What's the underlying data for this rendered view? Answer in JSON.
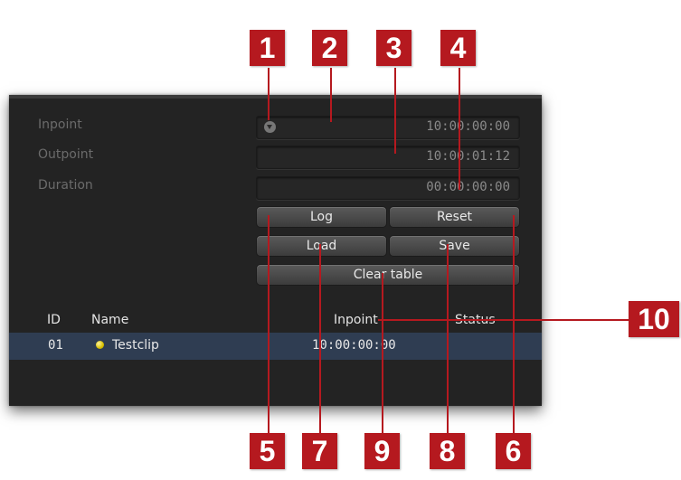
{
  "fields": {
    "inpoint_label": "Inpoint",
    "outpoint_label": "Outpoint",
    "duration_label": "Duration",
    "inpoint_value": "10:00:00:00",
    "outpoint_value": "10:00:01:12",
    "duration_value": "00:00:00:00"
  },
  "buttons": {
    "log": "Log",
    "reset": "Reset",
    "load": "Load",
    "save": "Save",
    "clear_table": "Clear table"
  },
  "table": {
    "columns": [
      "ID",
      "Name",
      "Inpoint",
      "Status"
    ],
    "rows": [
      {
        "id": "01",
        "name": "Testclip",
        "inpoint": "10:00:00:00",
        "status": "",
        "status_color": "#e3cc1a"
      }
    ]
  },
  "callouts": [
    "1",
    "2",
    "3",
    "4",
    "5",
    "6",
    "7",
    "8",
    "9",
    "10"
  ],
  "colors": {
    "callout": "#b5191f",
    "panel": "#232323",
    "selected_row": "#2f3d52"
  }
}
